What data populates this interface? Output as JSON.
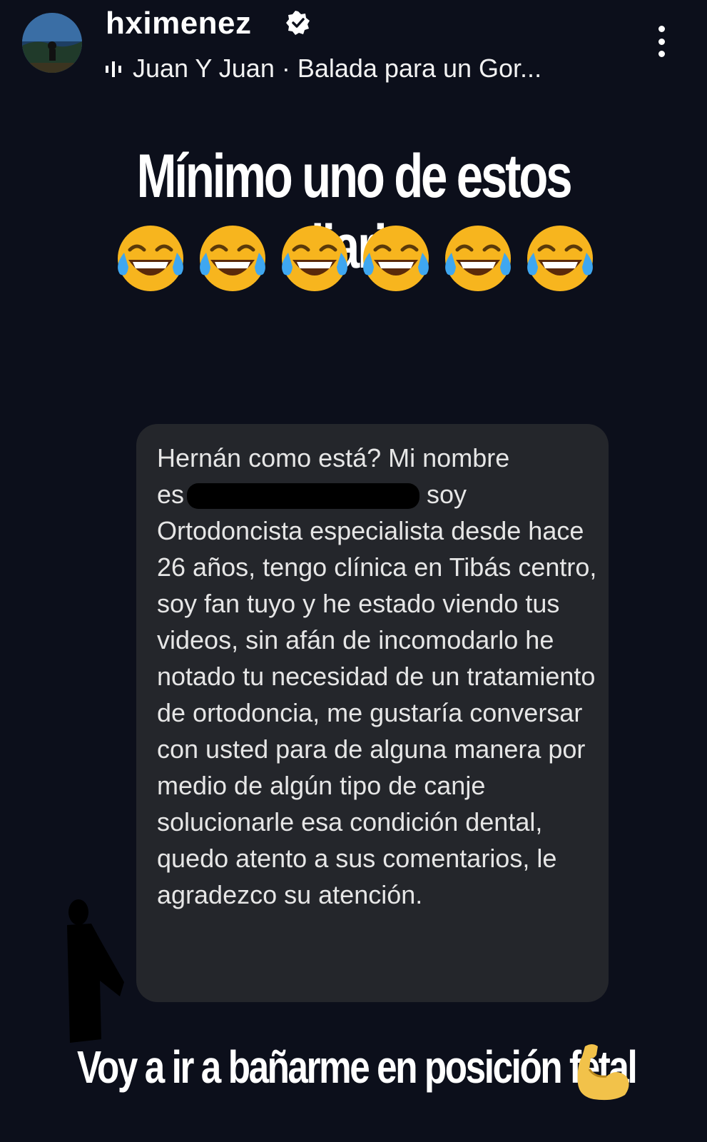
{
  "header": {
    "username": "hximenez",
    "music": "Juan Y Juan · Balada para un Gor..."
  },
  "headline": "Mínimo uno de estos diario",
  "emojis": [
    "joy-emoji",
    "joy-emoji",
    "joy-emoji",
    "joy-emoji",
    "joy-emoji",
    "joy-emoji"
  ],
  "message": {
    "line1": "Hernán como está? Mi nombre",
    "line2_start": "es",
    "line2_end": "soy",
    "body": "Ortodoncista especialista desde hace 26 años, tengo clínica en Tibás centro, soy fan tuyo y he estado viendo tus videos, sin afán de incomodarlo he notado tu necesidad de un tratamiento de ortodoncia, me gustaría conversar con usted para de alguna manera por medio de algún tipo de canje solucionarle esa condición dental, quedo atento a sus comentarios, le agradezco su atención."
  },
  "footer": {
    "caption": "Voy a ir a bañarme en posición fetal"
  },
  "colors": {
    "background": "#0c0f1b",
    "bubble": "#24262b",
    "emoji_face": "#f7b51e"
  }
}
